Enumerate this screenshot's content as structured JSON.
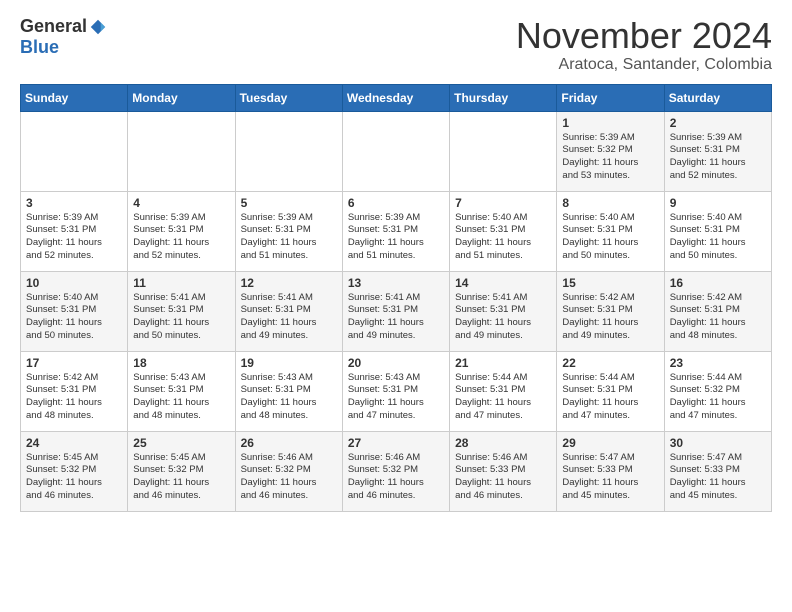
{
  "header": {
    "logo_general": "General",
    "logo_blue": "Blue",
    "month_title": "November 2024",
    "location": "Aratoca, Santander, Colombia"
  },
  "calendar": {
    "days_of_week": [
      "Sunday",
      "Monday",
      "Tuesday",
      "Wednesday",
      "Thursday",
      "Friday",
      "Saturday"
    ],
    "weeks": [
      [
        {
          "day": "",
          "info": ""
        },
        {
          "day": "",
          "info": ""
        },
        {
          "day": "",
          "info": ""
        },
        {
          "day": "",
          "info": ""
        },
        {
          "day": "",
          "info": ""
        },
        {
          "day": "1",
          "info": "Sunrise: 5:39 AM\nSunset: 5:32 PM\nDaylight: 11 hours\nand 53 minutes."
        },
        {
          "day": "2",
          "info": "Sunrise: 5:39 AM\nSunset: 5:31 PM\nDaylight: 11 hours\nand 52 minutes."
        }
      ],
      [
        {
          "day": "3",
          "info": "Sunrise: 5:39 AM\nSunset: 5:31 PM\nDaylight: 11 hours\nand 52 minutes."
        },
        {
          "day": "4",
          "info": "Sunrise: 5:39 AM\nSunset: 5:31 PM\nDaylight: 11 hours\nand 52 minutes."
        },
        {
          "day": "5",
          "info": "Sunrise: 5:39 AM\nSunset: 5:31 PM\nDaylight: 11 hours\nand 51 minutes."
        },
        {
          "day": "6",
          "info": "Sunrise: 5:39 AM\nSunset: 5:31 PM\nDaylight: 11 hours\nand 51 minutes."
        },
        {
          "day": "7",
          "info": "Sunrise: 5:40 AM\nSunset: 5:31 PM\nDaylight: 11 hours\nand 51 minutes."
        },
        {
          "day": "8",
          "info": "Sunrise: 5:40 AM\nSunset: 5:31 PM\nDaylight: 11 hours\nand 50 minutes."
        },
        {
          "day": "9",
          "info": "Sunrise: 5:40 AM\nSunset: 5:31 PM\nDaylight: 11 hours\nand 50 minutes."
        }
      ],
      [
        {
          "day": "10",
          "info": "Sunrise: 5:40 AM\nSunset: 5:31 PM\nDaylight: 11 hours\nand 50 minutes."
        },
        {
          "day": "11",
          "info": "Sunrise: 5:41 AM\nSunset: 5:31 PM\nDaylight: 11 hours\nand 50 minutes."
        },
        {
          "day": "12",
          "info": "Sunrise: 5:41 AM\nSunset: 5:31 PM\nDaylight: 11 hours\nand 49 minutes."
        },
        {
          "day": "13",
          "info": "Sunrise: 5:41 AM\nSunset: 5:31 PM\nDaylight: 11 hours\nand 49 minutes."
        },
        {
          "day": "14",
          "info": "Sunrise: 5:41 AM\nSunset: 5:31 PM\nDaylight: 11 hours\nand 49 minutes."
        },
        {
          "day": "15",
          "info": "Sunrise: 5:42 AM\nSunset: 5:31 PM\nDaylight: 11 hours\nand 49 minutes."
        },
        {
          "day": "16",
          "info": "Sunrise: 5:42 AM\nSunset: 5:31 PM\nDaylight: 11 hours\nand 48 minutes."
        }
      ],
      [
        {
          "day": "17",
          "info": "Sunrise: 5:42 AM\nSunset: 5:31 PM\nDaylight: 11 hours\nand 48 minutes."
        },
        {
          "day": "18",
          "info": "Sunrise: 5:43 AM\nSunset: 5:31 PM\nDaylight: 11 hours\nand 48 minutes."
        },
        {
          "day": "19",
          "info": "Sunrise: 5:43 AM\nSunset: 5:31 PM\nDaylight: 11 hours\nand 48 minutes."
        },
        {
          "day": "20",
          "info": "Sunrise: 5:43 AM\nSunset: 5:31 PM\nDaylight: 11 hours\nand 47 minutes."
        },
        {
          "day": "21",
          "info": "Sunrise: 5:44 AM\nSunset: 5:31 PM\nDaylight: 11 hours\nand 47 minutes."
        },
        {
          "day": "22",
          "info": "Sunrise: 5:44 AM\nSunset: 5:31 PM\nDaylight: 11 hours\nand 47 minutes."
        },
        {
          "day": "23",
          "info": "Sunrise: 5:44 AM\nSunset: 5:32 PM\nDaylight: 11 hours\nand 47 minutes."
        }
      ],
      [
        {
          "day": "24",
          "info": "Sunrise: 5:45 AM\nSunset: 5:32 PM\nDaylight: 11 hours\nand 46 minutes."
        },
        {
          "day": "25",
          "info": "Sunrise: 5:45 AM\nSunset: 5:32 PM\nDaylight: 11 hours\nand 46 minutes."
        },
        {
          "day": "26",
          "info": "Sunrise: 5:46 AM\nSunset: 5:32 PM\nDaylight: 11 hours\nand 46 minutes."
        },
        {
          "day": "27",
          "info": "Sunrise: 5:46 AM\nSunset: 5:32 PM\nDaylight: 11 hours\nand 46 minutes."
        },
        {
          "day": "28",
          "info": "Sunrise: 5:46 AM\nSunset: 5:33 PM\nDaylight: 11 hours\nand 46 minutes."
        },
        {
          "day": "29",
          "info": "Sunrise: 5:47 AM\nSunset: 5:33 PM\nDaylight: 11 hours\nand 45 minutes."
        },
        {
          "day": "30",
          "info": "Sunrise: 5:47 AM\nSunset: 5:33 PM\nDaylight: 11 hours\nand 45 minutes."
        }
      ]
    ]
  }
}
